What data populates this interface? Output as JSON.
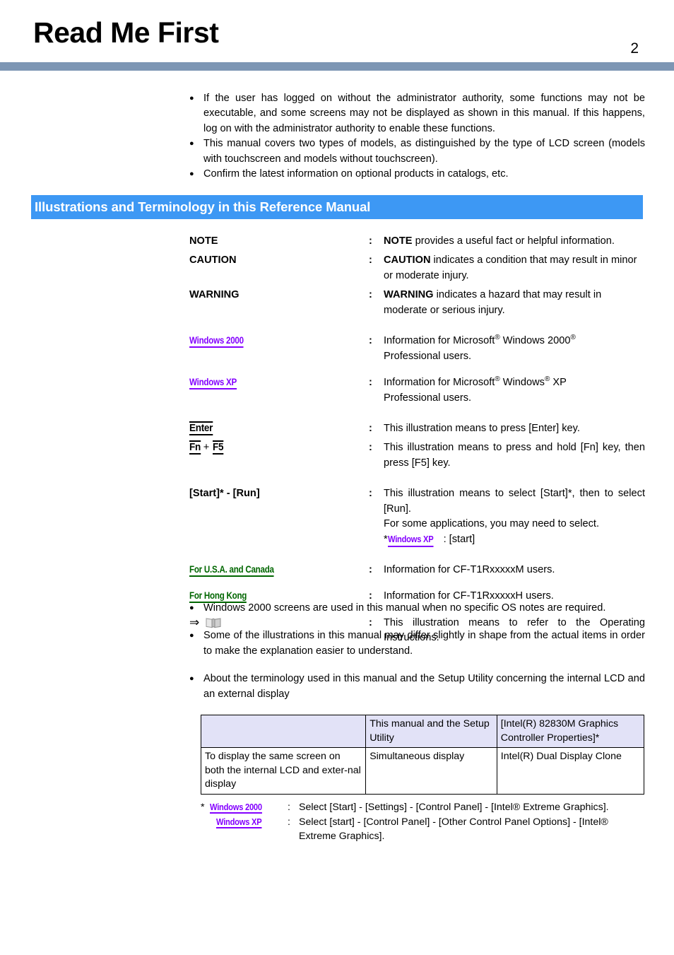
{
  "header": {
    "title": "Read Me First",
    "page_number": "2",
    "rule_color": "#7d96b4"
  },
  "intro_bullets": [
    "If the user has logged on without the administrator authority, some functions may not be executable, and some screens may not be displayed as shown in this manual. If this happens, log on with the administrator authority to enable these functions.",
    "This manual covers two types of models, as distinguished by the type of LCD screen (models with touchscreen and models without touchscreen).",
    "Confirm the latest information on optional products in catalogs, etc."
  ],
  "section": {
    "title": "Illustrations and Terminology in this Reference Manual",
    "bar_color": "#3d98f4",
    "text_color": "#ffffff"
  },
  "colors": {
    "windows_badge": "#8400ff",
    "region_badge": "#006600",
    "table_header_bg": "#e2e2f7"
  },
  "definitions": {
    "colon": ":",
    "note": {
      "term": "NOTE",
      "desc_bold": "NOTE",
      "desc_rest": " provides a useful fact or helpful information."
    },
    "caution": {
      "term": "CAUTION",
      "desc_bold": "CAUTION",
      "desc_rest": " indicates a condition that may result in minor or moderate injury."
    },
    "warning": {
      "term": "WARNING",
      "desc_bold": "WARNING",
      "desc_rest": " indicates a hazard that may result in moderate or serious injury."
    },
    "win2000": {
      "term": "Windows 2000",
      "desc_p1": "Information for Microsoft",
      "desc_p2": " Windows 2000",
      "desc_p3": "Professional users.",
      "reg": "®"
    },
    "winxp": {
      "term": "Windows XP",
      "desc_p1": "Information for Microsoft",
      "desc_p2": " Windows",
      "desc_p3": " XP",
      "desc_p4": "Professional users.",
      "reg": "®"
    },
    "enter": {
      "term": "Enter",
      "desc": "This illustration means to press [Enter] key."
    },
    "fnf5": {
      "term_a": "Fn",
      "term_plus": "+",
      "term_b": "F5",
      "desc": "This illustration means to press and hold [Fn] key, then press [F5] key."
    },
    "startrun": {
      "term": "[Start]* - [Run]",
      "desc_l1": "This illustration means to select [Start]*, then to select [Run].",
      "desc_l2": "For some applications, you may need to select.",
      "desc_l3_star": "*",
      "desc_l3_badge": "Windows XP",
      "desc_l3_rest": ": [start]"
    },
    "usa_canada": {
      "term": "For U.S.A. and Canada",
      "desc": "Information for CF-T1RxxxxxM users."
    },
    "hong_kong": {
      "term": "For Hong Kong",
      "desc": "Information for CF-T1RxxxxxH users."
    },
    "operating_instructions": {
      "term_arrow": "⇒",
      "term_icon": "book-icon",
      "desc": "This illustration means to refer to the Operating Instructions."
    }
  },
  "lower_bullets": [
    "Windows 2000 screens are used in this manual when no specific OS notes are required.",
    "Some of the illustrations in this manual may differ slightly in shape from the actual items in order to make the explanation easier to understand.",
    "About the terminology used in this manual and the Setup Utility concerning the internal LCD and an external display"
  ],
  "table": {
    "headers": [
      "",
      "This manual and the Setup Utility",
      "[Intel(R) 82830M Graphics Controller Properties]*"
    ],
    "rows": [
      [
        "To display the same screen on both the internal LCD and exter-nal display",
        "Simultaneous display",
        "Intel(R) Dual Display Clone"
      ]
    ]
  },
  "footnote": {
    "star": "*",
    "line1": {
      "badge": "Windows 2000",
      "colon": ":",
      "text": "Select  [Start] - [Settings] - [Control Panel] - [Intel® Extreme Graphics]."
    },
    "line2": {
      "badge": "Windows XP",
      "colon": ":",
      "text": "Select  [start] - [Control Panel] - [Other Control Panel Options] - [Intel®",
      "text_cont": "Extreme Graphics]."
    }
  }
}
